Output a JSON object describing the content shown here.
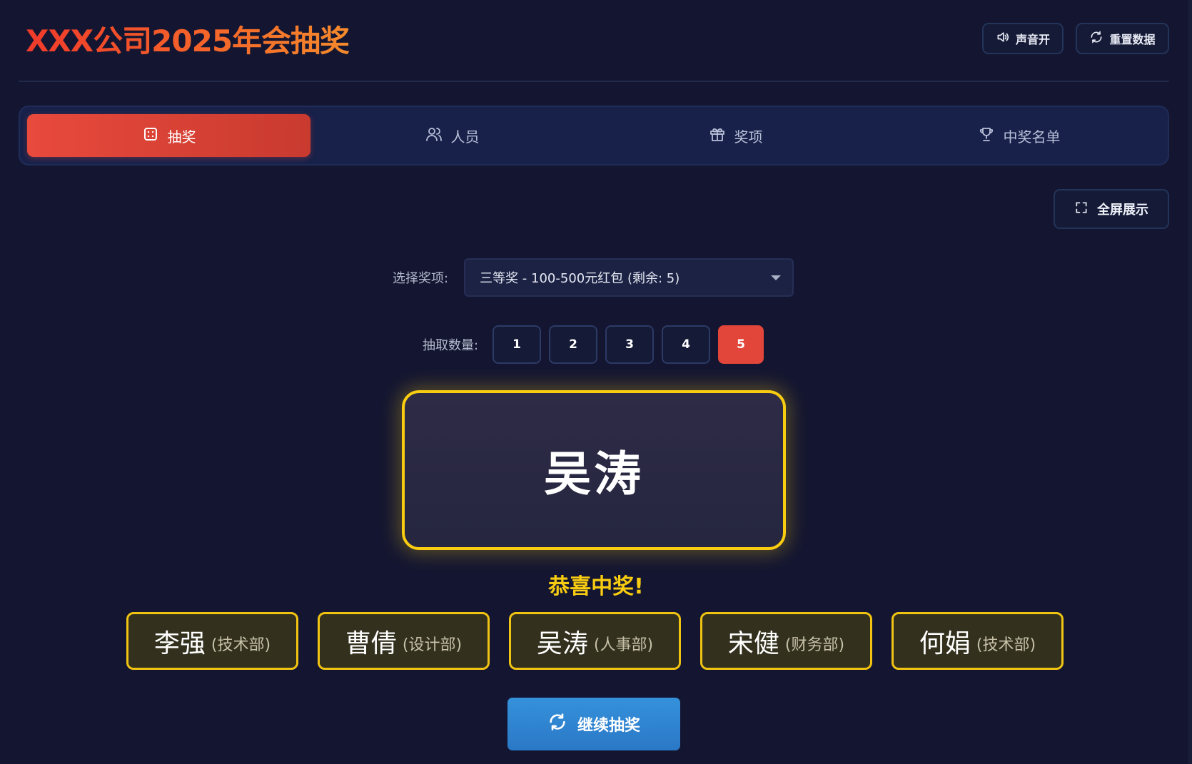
{
  "header": {
    "title": "XXX公司2025年会抽奖",
    "sound_label": "声音开",
    "reset_label": "重置数据"
  },
  "tabs": [
    {
      "label": "抽奖",
      "icon": "dice-icon",
      "active": true
    },
    {
      "label": "人员",
      "icon": "users-icon",
      "active": false
    },
    {
      "label": "奖项",
      "icon": "gift-icon",
      "active": false
    },
    {
      "label": "中奖名单",
      "icon": "trophy-icon",
      "active": false
    }
  ],
  "fullscreen_label": "全屏展示",
  "prize_select": {
    "label": "选择奖项:",
    "selected": "三等奖 - 100-500元红包 (剩余: 5)"
  },
  "count_select": {
    "label": "抽取数量:",
    "options": [
      "1",
      "2",
      "3",
      "4",
      "5"
    ],
    "selected": "5"
  },
  "display": {
    "current_name": "吴涛",
    "congrats": "恭喜中奖!"
  },
  "winners": [
    {
      "name": "李强",
      "dept": "(技术部)"
    },
    {
      "name": "曹倩",
      "dept": "(设计部)"
    },
    {
      "name": "吴涛",
      "dept": "(人事部)"
    },
    {
      "name": "宋健",
      "dept": "(财务部)"
    },
    {
      "name": "何娟",
      "dept": "(技术部)"
    }
  ],
  "continue_label": "继续抽奖",
  "colors": {
    "background": "#141631",
    "accent_red": "#e2463a",
    "gold": "#f8cc10",
    "blue_button": "#2f86d2"
  }
}
